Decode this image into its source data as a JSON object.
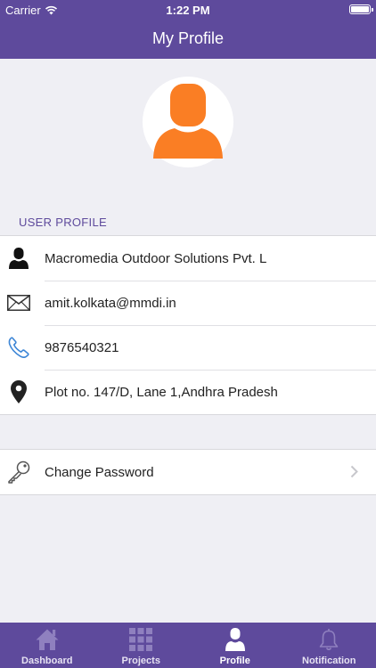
{
  "status": {
    "carrier": "Carrier",
    "time": "1:22 PM"
  },
  "header": {
    "title": "My Profile"
  },
  "profile": {
    "section_label": "USER PROFILE",
    "company": "Macromedia Outdoor Solutions Pvt. L",
    "email": "amit.kolkata@mmdi.in",
    "phone": "9876540321",
    "address": "Plot no. 147/D, Lane 1,Andhra Pradesh"
  },
  "settings": {
    "change_password": "Change Password"
  },
  "tabs": [
    {
      "label": "Dashboard",
      "icon": "home-icon"
    },
    {
      "label": "Projects",
      "icon": "grid-icon"
    },
    {
      "label": "Profile",
      "icon": "person-icon",
      "active": true
    },
    {
      "label": "Notification",
      "icon": "bell-icon"
    }
  ],
  "colors": {
    "brand": "#5e4a9c",
    "avatar": "#fa7e24",
    "phone_icon": "#3d86d6"
  }
}
